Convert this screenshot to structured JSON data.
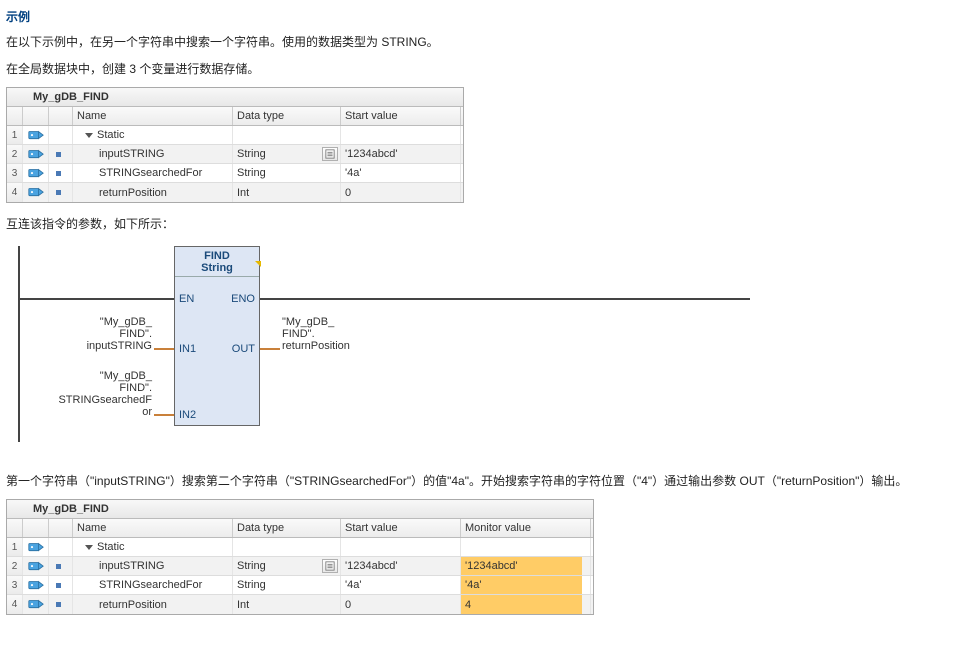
{
  "heading": "示例",
  "para1": "在以下示例中，在另一个字符串中搜索一个字符串。使用的数据类型为 STRING。",
  "para2": "在全局数据块中，创建 3 个变量进行数据存储。",
  "para3": "互连该指令的参数，如下所示：",
  "para4": "第一个字符串（\"inputSTRING\"）搜索第二个字符串（\"STRINGsearchedFor\"）的值\"4a\"。开始搜索字符串的字符位置（\"4\"）通过输出参数 OUT（\"returnPosition\"）输出。",
  "table1": {
    "title": "My_gDB_FIND",
    "cols": {
      "name": "Name",
      "dtype": "Data type",
      "start": "Start value"
    },
    "rows": [
      {
        "n": "1",
        "type": "header",
        "name": "Static"
      },
      {
        "n": "2",
        "type": "var",
        "name": "inputSTRING",
        "dtype": "String",
        "start": "'1234abcd'",
        "ddl": true
      },
      {
        "n": "3",
        "type": "var",
        "name": "STRINGsearchedFor",
        "dtype": "String",
        "start": "'4a'"
      },
      {
        "n": "4",
        "type": "var",
        "name": "returnPosition",
        "dtype": "Int",
        "start": "0"
      }
    ]
  },
  "table2": {
    "title": "My_gDB_FIND",
    "cols": {
      "name": "Name",
      "dtype": "Data type",
      "start": "Start value",
      "monit": "Monitor value"
    },
    "rows": [
      {
        "n": "1",
        "type": "header",
        "name": "Static"
      },
      {
        "n": "2",
        "type": "var",
        "name": "inputSTRING",
        "dtype": "String",
        "start": "'1234abcd'",
        "monit": "'1234abcd'",
        "ddl": true
      },
      {
        "n": "3",
        "type": "var",
        "name": "STRINGsearchedFor",
        "dtype": "String",
        "start": "'4a'",
        "monit": "'4a'"
      },
      {
        "n": "4",
        "type": "var",
        "name": "returnPosition",
        "dtype": "Int",
        "start": "0",
        "monit": "4"
      }
    ]
  },
  "diagram": {
    "block_name": "FIND",
    "block_type": "String",
    "ports": {
      "en": "EN",
      "eno": "ENO",
      "in1": "IN1",
      "in2": "IN2",
      "out": "OUT"
    },
    "sig_in1_l1": "\"My_gDB_",
    "sig_in1_l2": "FIND\".",
    "sig_in1_l3": "inputSTRING",
    "sig_in2_l1": "\"My_gDB_",
    "sig_in2_l2": "FIND\".",
    "sig_in2_l3": "STRINGsearchedF",
    "sig_in2_l4": "or",
    "sig_out_l1": "\"My_gDB_",
    "sig_out_l2": "FIND\".",
    "sig_out_l3": "returnPosition"
  }
}
